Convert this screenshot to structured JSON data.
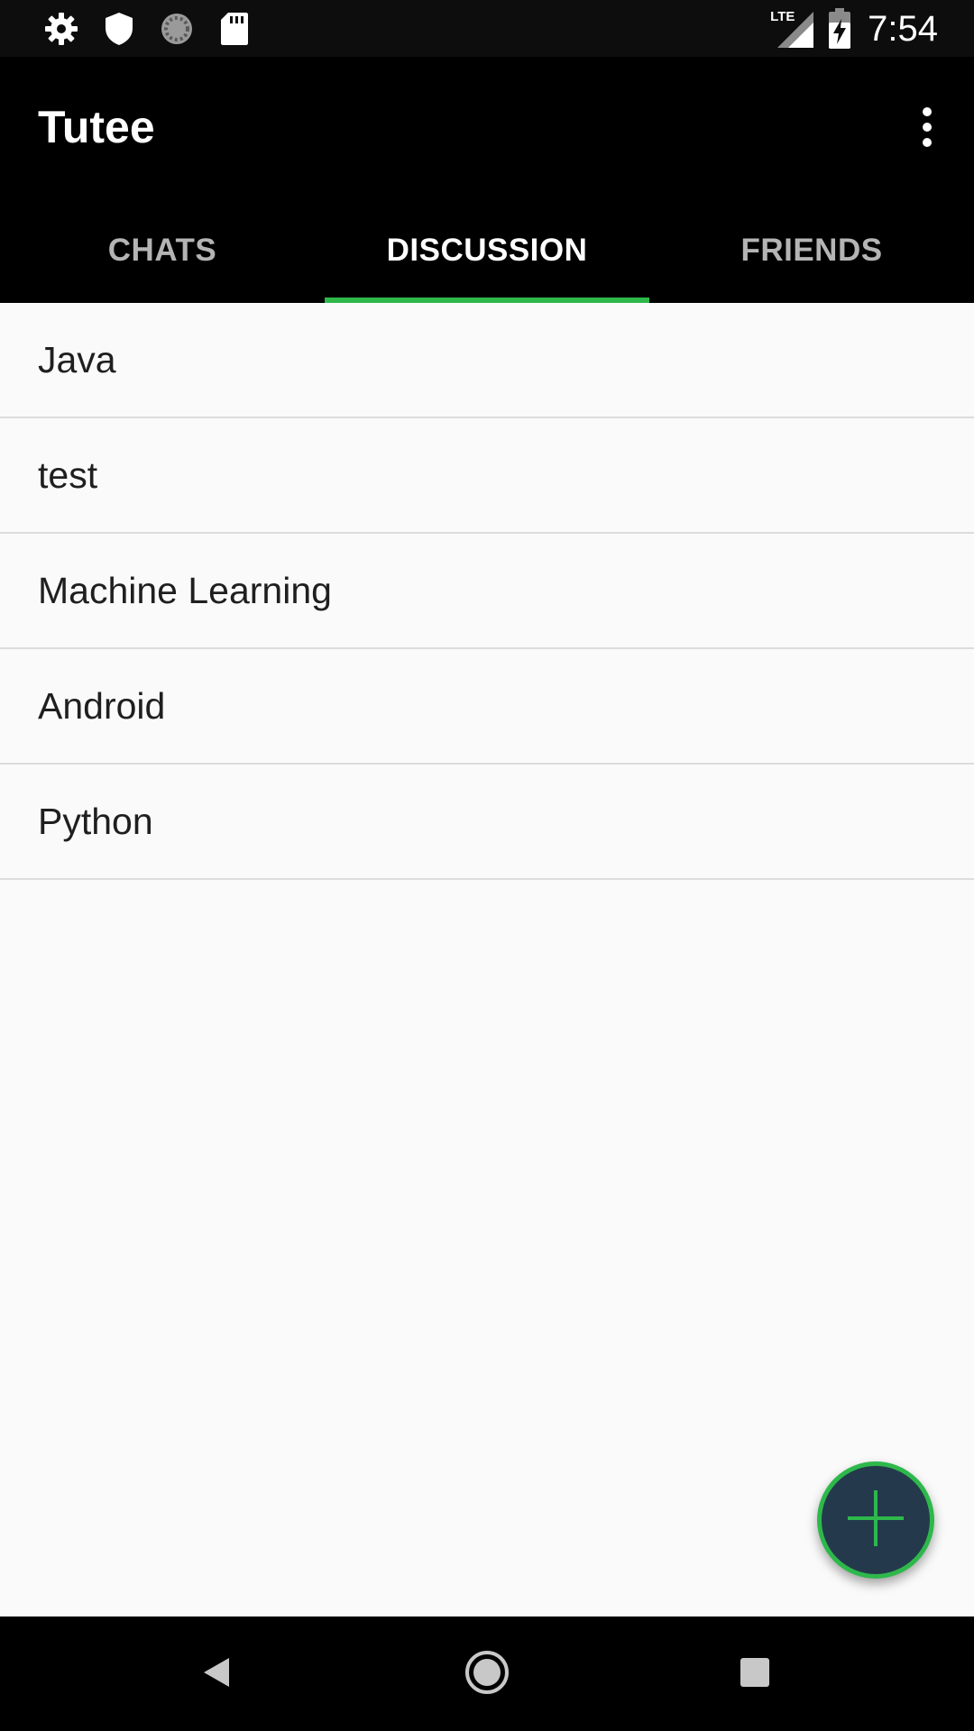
{
  "status_bar": {
    "time": "7:54",
    "network_label": "LTE",
    "left_icons": [
      "gear-icon",
      "shield-icon",
      "sync-icon",
      "sd-card-icon"
    ],
    "right_icons": [
      "lte-signal-icon",
      "battery-charging-icon"
    ]
  },
  "app_bar": {
    "title": "Tutee",
    "menu_icon": "more-vert-icon"
  },
  "tabs": [
    {
      "label": "CHATS",
      "active": false
    },
    {
      "label": "DISCUSSION",
      "active": true
    },
    {
      "label": "FRIENDS",
      "active": false
    }
  ],
  "discussions": [
    {
      "label": "Java"
    },
    {
      "label": "test"
    },
    {
      "label": "Machine Learning"
    },
    {
      "label": "Android"
    },
    {
      "label": "Python"
    }
  ],
  "fab": {
    "icon": "plus-icon"
  },
  "nav_bar": {
    "icons": [
      "back-icon",
      "home-icon",
      "recents-icon"
    ]
  },
  "colors": {
    "accent": "#2eb84b",
    "app_bar": "#000000",
    "background": "#fafafa",
    "fab_fill": "#243a4c",
    "tab_inactive": "#b4b4b4"
  }
}
